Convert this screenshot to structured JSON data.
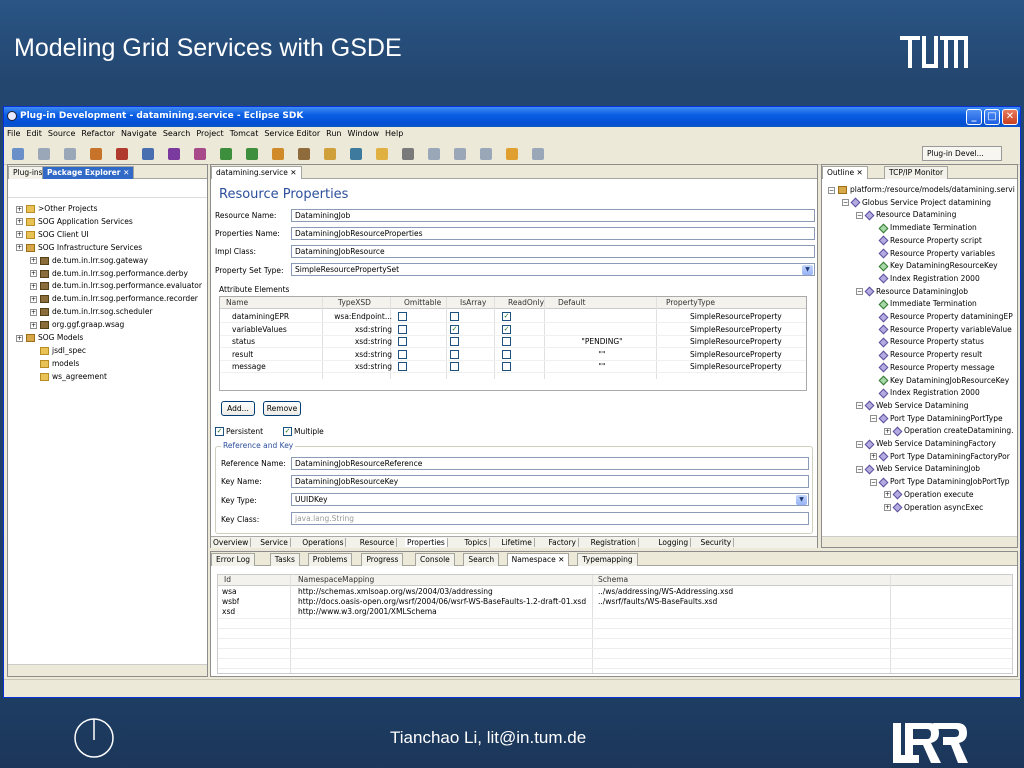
{
  "slide": {
    "title": "Modeling Grid Services with GSDE",
    "footer": "Tianchao Li, lit@in.tum.de"
  },
  "window": {
    "title": "Plug-in Development - datamining.service - Eclipse SDK"
  },
  "menu": [
    "File",
    "Edit",
    "Source",
    "Refactor",
    "Navigate",
    "Search",
    "Project",
    "Tomcat",
    "Service Editor",
    "Run",
    "Window",
    "Help"
  ],
  "perspective": {
    "label": "Plug-in Devel..."
  },
  "left_panel": {
    "tabs": [
      "Plug-ins",
      "Package Explorer"
    ],
    "tree": [
      {
        "label": ">Other Projects",
        "indent": 0,
        "icon": "folder"
      },
      {
        "label": "SOG Application Services",
        "indent": 0,
        "icon": "folder"
      },
      {
        "label": "SOG Client UI",
        "indent": 0,
        "icon": "folder"
      },
      {
        "label": "SOG Infrastructure Services",
        "indent": 0,
        "icon": "proj"
      },
      {
        "label": "de.tum.in.lrr.sog.gateway",
        "indent": 1,
        "icon": "pkg"
      },
      {
        "label": "de.tum.in.lrr.sog.performance.derby",
        "indent": 1,
        "icon": "pkg"
      },
      {
        "label": "de.tum.in.lrr.sog.performance.evaluator",
        "indent": 1,
        "icon": "pkg"
      },
      {
        "label": "de.tum.in.lrr.sog.performance.recorder",
        "indent": 1,
        "icon": "pkg"
      },
      {
        "label": "de.tum.in.lrr.sog.scheduler",
        "indent": 1,
        "icon": "pkg"
      },
      {
        "label": "org.ggf.graap.wsag",
        "indent": 1,
        "icon": "pkg"
      },
      {
        "label": "SOG Models",
        "indent": 0,
        "icon": "proj"
      },
      {
        "label": "jsdl_spec",
        "indent": 1,
        "icon": "folder"
      },
      {
        "label": "models",
        "indent": 1,
        "icon": "folder"
      },
      {
        "label": "ws_agreement",
        "indent": 1,
        "icon": "folder"
      }
    ]
  },
  "editor": {
    "tab": "datamining.service",
    "heading": "Resource Properties",
    "resource_name_label": "Resource Name:",
    "resource_name": "DataminingJob",
    "properties_name_label": "Properties Name:",
    "properties_name": "DataminingJobResourceProperties",
    "impl_class_label": "Impl Class:",
    "impl_class": "DataminingJobResource",
    "property_set_type_label": "Property Set Type:",
    "property_set_type": "SimpleResourcePropertySet",
    "attribute_elements_label": "Attribute Elements",
    "columns": [
      "Name",
      "TypeXSD",
      "Omittable",
      "IsArray",
      "ReadOnly",
      "Default",
      "PropertyType"
    ],
    "rows": [
      {
        "name": "dataminingEPR",
        "type": "wsa:Endpoint...",
        "omittable": false,
        "isarray": false,
        "readonly": true,
        "default": "",
        "ptype": "SimpleResourceProperty"
      },
      {
        "name": "variableValues",
        "type": "xsd:string",
        "omittable": false,
        "isarray": true,
        "readonly": true,
        "default": "",
        "ptype": "SimpleResourceProperty"
      },
      {
        "name": "status",
        "type": "xsd:string",
        "omittable": false,
        "isarray": false,
        "readonly": false,
        "default": "\"PENDING\"",
        "ptype": "SimpleResourceProperty"
      },
      {
        "name": "result",
        "type": "xsd:string",
        "omittable": false,
        "isarray": false,
        "readonly": false,
        "default": "\"\"",
        "ptype": "SimpleResourceProperty"
      },
      {
        "name": "message",
        "type": "xsd:string",
        "omittable": false,
        "isarray": false,
        "readonly": false,
        "default": "\"\"",
        "ptype": "SimpleResourceProperty"
      }
    ],
    "add_label": "Add...",
    "remove_label": "Remove",
    "persistent_label": "Persistent",
    "multiple_label": "Multiple",
    "ref_group_label": "Reference and Key",
    "ref_name_label": "Reference Name:",
    "ref_name": "DataminingJobResourceReference",
    "key_name_label": "Key Name:",
    "key_name": "DataminingJobResourceKey",
    "key_type_label": "Key Type:",
    "key_type": "UUIDKey",
    "key_class_label": "Key Class:",
    "key_class": "java.lang.String",
    "bottom_tabs": [
      "Overview",
      "Service",
      "Operations",
      "Resource",
      "Properties",
      "Topics",
      "Lifetime",
      "Factory",
      "Registration",
      "Logging",
      "Security"
    ]
  },
  "outline": {
    "tabs": [
      "Outline",
      "TCP/IP Monitor"
    ],
    "tree": [
      {
        "label": "platform:/resource/models/datamining.servi",
        "indent": 0,
        "icon": "proj",
        "exp": "-"
      },
      {
        "label": "Globus Service Project datamining",
        "indent": 1,
        "icon": "dia",
        "exp": "-"
      },
      {
        "label": "Resource Datamining",
        "indent": 2,
        "icon": "dia",
        "exp": "-"
      },
      {
        "label": "Immediate Termination",
        "indent": 3,
        "icon": "diag",
        "exp": ""
      },
      {
        "label": "Resource Property script",
        "indent": 3,
        "icon": "dia",
        "exp": ""
      },
      {
        "label": "Resource Property variables",
        "indent": 3,
        "icon": "dia",
        "exp": ""
      },
      {
        "label": "Key DataminingResourceKey",
        "indent": 3,
        "icon": "diag",
        "exp": ""
      },
      {
        "label": "Index Registration 2000",
        "indent": 3,
        "icon": "dia",
        "exp": ""
      },
      {
        "label": "Resource DataminingJob",
        "indent": 2,
        "icon": "dia",
        "exp": "-"
      },
      {
        "label": "Immediate Termination",
        "indent": 3,
        "icon": "diag",
        "exp": ""
      },
      {
        "label": "Resource Property dataminingEP",
        "indent": 3,
        "icon": "dia",
        "exp": ""
      },
      {
        "label": "Resource Property variableValue",
        "indent": 3,
        "icon": "dia",
        "exp": ""
      },
      {
        "label": "Resource Property status",
        "indent": 3,
        "icon": "dia",
        "exp": ""
      },
      {
        "label": "Resource Property result",
        "indent": 3,
        "icon": "dia",
        "exp": ""
      },
      {
        "label": "Resource Property message",
        "indent": 3,
        "icon": "dia",
        "exp": ""
      },
      {
        "label": "Key DataminingJobResourceKey",
        "indent": 3,
        "icon": "diag",
        "exp": ""
      },
      {
        "label": "Index Registration 2000",
        "indent": 3,
        "icon": "dia",
        "exp": ""
      },
      {
        "label": "Web Service Datamining",
        "indent": 2,
        "icon": "dia",
        "exp": "-"
      },
      {
        "label": "Port Type DataminingPortType",
        "indent": 3,
        "icon": "dia",
        "exp": "-"
      },
      {
        "label": "Operation createDatamining.",
        "indent": 4,
        "icon": "dia",
        "exp": "+"
      },
      {
        "label": "Web Service DataminingFactory",
        "indent": 2,
        "icon": "dia",
        "exp": "-"
      },
      {
        "label": "Port Type DataminingFactoryPor",
        "indent": 3,
        "icon": "dia",
        "exp": "+"
      },
      {
        "label": "Web Service DataminingJob",
        "indent": 2,
        "icon": "dia",
        "exp": "-"
      },
      {
        "label": "Port Type DataminingJobPortTyp",
        "indent": 3,
        "icon": "dia",
        "exp": "-"
      },
      {
        "label": "Operation execute",
        "indent": 4,
        "icon": "dia",
        "exp": "+"
      },
      {
        "label": "Operation asyncExec",
        "indent": 4,
        "icon": "dia",
        "exp": "+"
      }
    ]
  },
  "bottom_panel": {
    "tabs": [
      "Error Log",
      "Tasks",
      "Problems",
      "Progress",
      "Console",
      "Search",
      "Namespace",
      "Typemapping"
    ],
    "columns": [
      "Id",
      "NamespaceMapping",
      "Schema"
    ],
    "rows": [
      {
        "id": "wsa",
        "mapping": "http://schemas.xmlsoap.org/ws/2004/03/addressing",
        "schema": "../ws/addressing/WS-Addressing.xsd"
      },
      {
        "id": "wsbf",
        "mapping": "http://docs.oasis-open.org/wsrf/2004/06/wsrf-WS-BaseFaults-1.2-draft-01.xsd",
        "schema": "../wsrf/faults/WS-BaseFaults.xsd"
      },
      {
        "id": "xsd",
        "mapping": "http://www.w3.org/2001/XMLSchema",
        "schema": ""
      }
    ]
  }
}
